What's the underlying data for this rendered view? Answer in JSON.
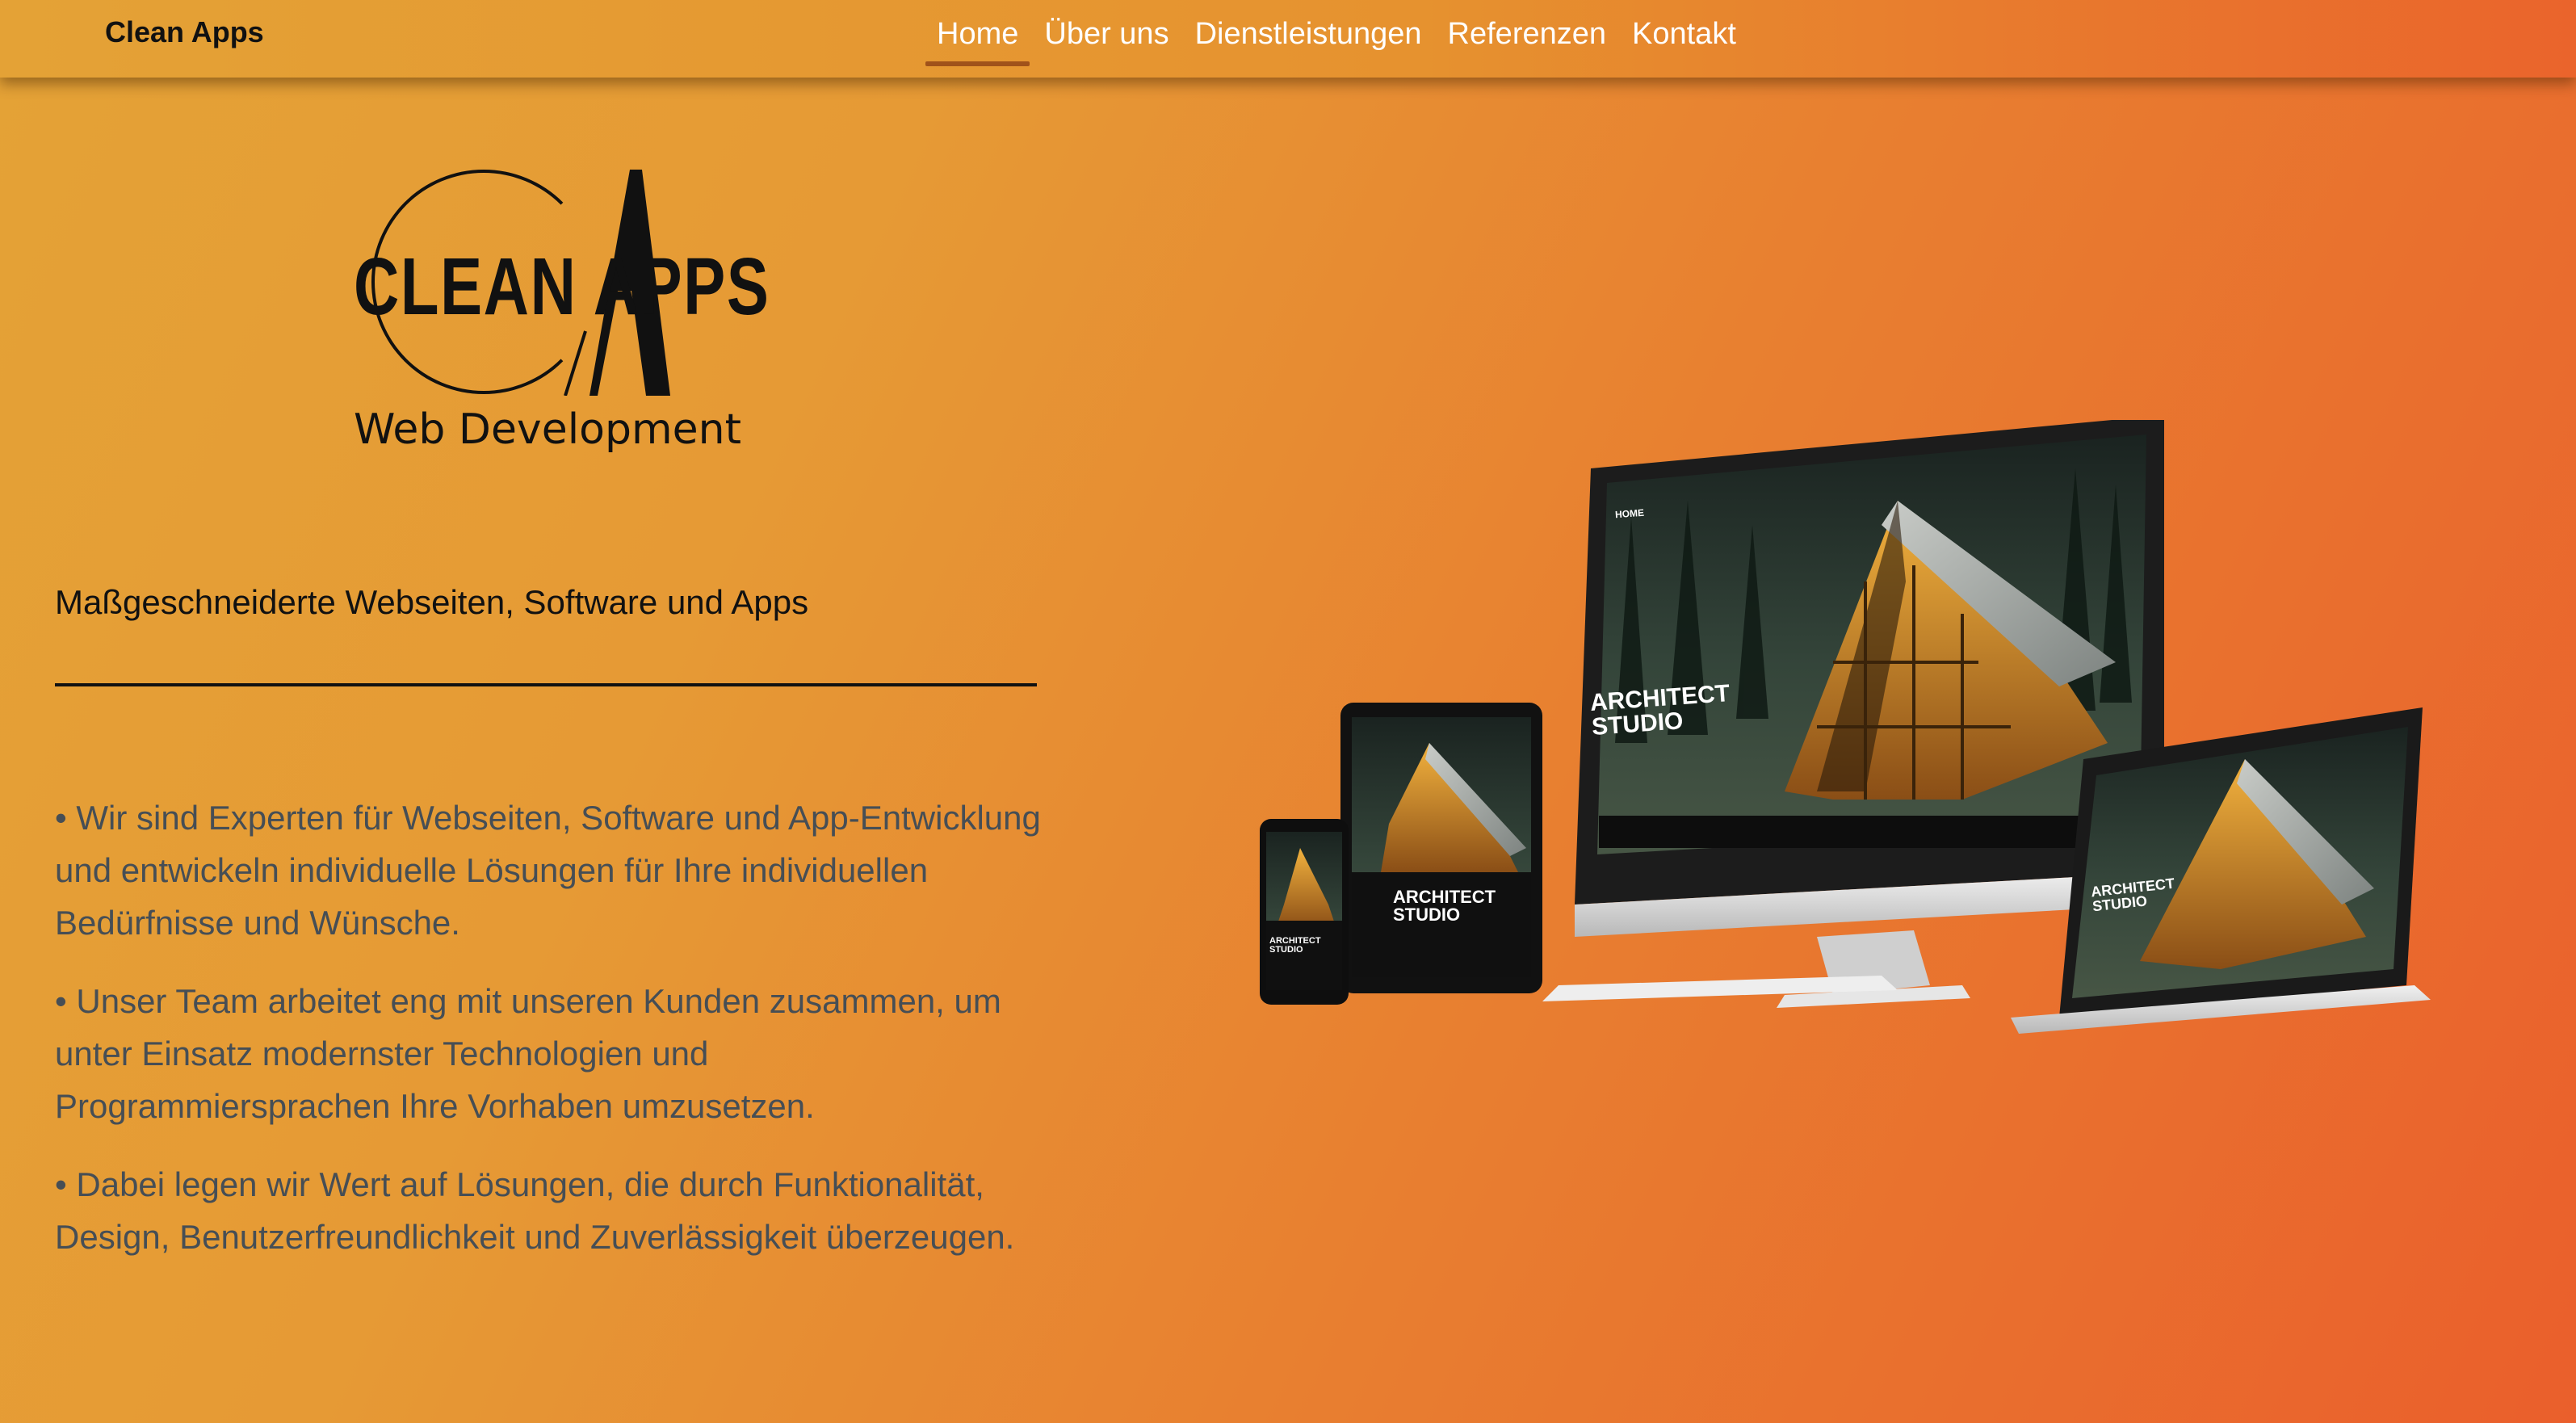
{
  "navbar": {
    "brand": "Clean Apps",
    "links": [
      {
        "label": "Home",
        "active": true
      },
      {
        "label": "Über uns",
        "active": false
      },
      {
        "label": "Dienstleistungen",
        "active": false
      },
      {
        "label": "Referenzen",
        "active": false
      },
      {
        "label": "Kontakt",
        "active": false
      }
    ]
  },
  "logo": {
    "title": "CLEAN APPS",
    "subtitle": "Web Development"
  },
  "hero": {
    "tagline": "Maßgeschneiderte Webseiten, Software und Apps",
    "bullets": [
      "• Wir sind Experten für Webseiten, Software und App-Entwicklung und entwickeln individuelle Lösungen für Ihre individuellen Bedürfnisse und Wünsche.",
      "• Unser Team arbeitet eng mit unseren Kunden zusammen, um unter Einsatz modernster Technologien und Programmiersprachen Ihre Vorhaben umzusetzen.",
      "• Dabei legen wir Wert auf Lösungen, die durch Funktionalität, Design, Benutzerfreundlichkeit und Zuverlässigkeit überzeugen."
    ]
  },
  "mockup": {
    "screen_title_line1": "ARCHITECT",
    "screen_title_line2": "STUDIO",
    "screen_nav": "HOME"
  },
  "colors": {
    "gradient_start": "#e4a236",
    "gradient_end": "#ea5f2c",
    "active_underline": "#a0521a",
    "body_text": "#464e55"
  }
}
